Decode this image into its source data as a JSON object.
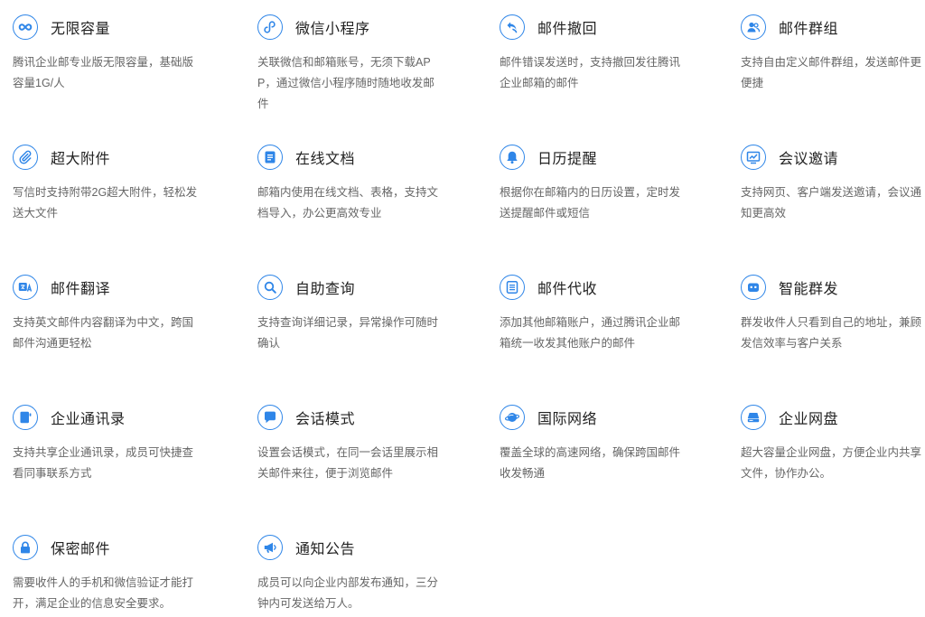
{
  "accent_color": "#2f86e8",
  "features": [
    {
      "icon": "infinity-icon",
      "title": "无限容量",
      "desc": "腾讯企业邮专业版无限容量，基础版容量1G/人"
    },
    {
      "icon": "miniprogram-icon",
      "title": "微信小程序",
      "desc": "关联微信和邮箱账号，无须下载APP，通过微信小程序随时随地收发邮件"
    },
    {
      "icon": "undo-arrow-icon",
      "title": "邮件撤回",
      "desc": "邮件错误发送时，支持撤回发往腾讯企业邮箱的邮件"
    },
    {
      "icon": "users-group-icon",
      "title": "邮件群组",
      "desc": "支持自由定义邮件群组，发送邮件更便捷"
    },
    {
      "icon": "paperclip-icon",
      "title": "超大附件",
      "desc": "写信时支持附带2G超大附件，轻松发送大文件"
    },
    {
      "icon": "document-icon",
      "title": "在线文档",
      "desc": "邮箱内使用在线文档、表格，支持文档导入，办公更高效专业"
    },
    {
      "icon": "bell-icon",
      "title": "日历提醒",
      "desc": "根据你在邮箱内的日历设置，定时发送提醒邮件或短信"
    },
    {
      "icon": "meeting-chart-icon",
      "title": "会议邀请",
      "desc": "支持网页、客户端发送邀请，会议通知更高效"
    },
    {
      "icon": "translate-icon",
      "title": "邮件翻译",
      "desc": "支持英文邮件内容翻译为中文，跨国邮件沟通更轻松"
    },
    {
      "icon": "search-icon",
      "title": "自助查询",
      "desc": "支持查询详细记录，异常操作可随时确认"
    },
    {
      "icon": "list-box-icon",
      "title": "邮件代收",
      "desc": "添加其他邮箱账户，通过腾讯企业邮箱统一收发其他账户的邮件"
    },
    {
      "icon": "robot-icon",
      "title": "智能群发",
      "desc": "群发收件人只看到自己的地址，兼顾发信效率与客户关系"
    },
    {
      "icon": "contact-book-icon",
      "title": "企业通讯录",
      "desc": "支持共享企业通讯录，成员可快捷查看同事联系方式"
    },
    {
      "icon": "chat-bubble-icon",
      "title": "会话模式",
      "desc": "设置会话模式，在同一会话里展示相关邮件来往，便于浏览邮件"
    },
    {
      "icon": "globe-planet-icon",
      "title": "国际网络",
      "desc": "覆盖全球的高速网络，确保跨国邮件收发畅通"
    },
    {
      "icon": "drive-icon",
      "title": "企业网盘",
      "desc": "超大容量企业网盘，方便企业内共享文件，协作办公。"
    },
    {
      "icon": "lock-icon",
      "title": "保密邮件",
      "desc": "需要收件人的手机和微信验证才能打开，满足企业的信息安全要求。"
    },
    {
      "icon": "megaphone-icon",
      "title": "通知公告",
      "desc": "成员可以向企业内部发布通知，三分钟内可发送给万人。"
    }
  ]
}
